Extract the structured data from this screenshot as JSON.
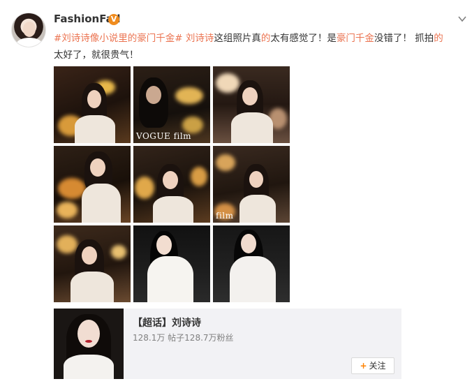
{
  "post": {
    "username": "FashionFad",
    "verified_badge": "V",
    "text_segments": [
      {
        "text": "#刘诗诗像小说里的豪门千金#",
        "style": "tag"
      },
      {
        "text": " ",
        "style": "normal"
      },
      {
        "text": "刘诗诗",
        "style": "tag"
      },
      {
        "text": "这组照片真",
        "style": "normal"
      },
      {
        "text": "的",
        "style": "hl"
      },
      {
        "text": "太有感觉了！是",
        "style": "normal"
      },
      {
        "text": "豪门千金",
        "style": "hl"
      },
      {
        "text": "没错了！ 抓拍",
        "style": "normal"
      },
      {
        "text": "的",
        "style": "hl"
      },
      {
        "text": "太好了，就很贵气！",
        "style": "normal"
      }
    ],
    "watermark": "VOGUE film",
    "watermark2": "film"
  },
  "card": {
    "title": "【超话】刘诗诗",
    "stats": "128.1万 帖子128.7万粉丝",
    "follow_label": "关注",
    "follow_icon": "plus-icon"
  },
  "colors": {
    "accent": "#eb7350",
    "badge": "#f08c1f",
    "follow_plus": "#ff8200",
    "card_bg": "#f2f2f5"
  }
}
